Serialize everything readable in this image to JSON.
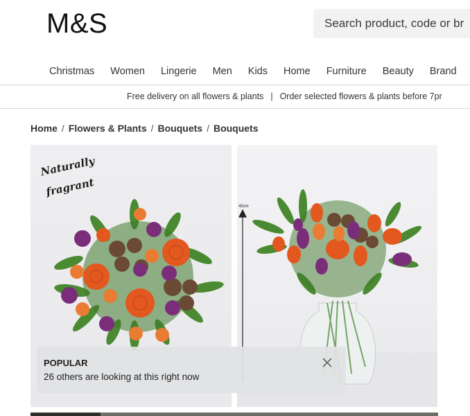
{
  "brand": {
    "logo_text": "M&S"
  },
  "search": {
    "placeholder": "Search product, code or br"
  },
  "nav": {
    "items": [
      "Christmas",
      "Women",
      "Lingerie",
      "Men",
      "Kids",
      "Home",
      "Furniture",
      "Beauty",
      "Brand"
    ]
  },
  "promo": {
    "left": "Free delivery on all flowers & plants",
    "separator": "|",
    "right": "Order selected flowers & plants before 7pr"
  },
  "breadcrumb": {
    "items": [
      "Home",
      "Flowers & Plants",
      "Bouquets",
      "Bouquets"
    ],
    "separator": "/"
  },
  "gallery": {
    "image1": {
      "overlay_lines": [
        "Naturally",
        "fragrant"
      ]
    },
    "image2": {
      "measure_label": "40cm"
    }
  },
  "popup": {
    "title": "POPULAR",
    "message": "26 others are looking at this right now"
  },
  "colors": {
    "flower_orange": "#e2581f",
    "flower_purple": "#7a2e7a",
    "leaf_green": "#3f7a2c",
    "popup_bg": "#e1e2e4"
  },
  "icons": [
    "close-icon",
    "arrow-up-icon"
  ]
}
